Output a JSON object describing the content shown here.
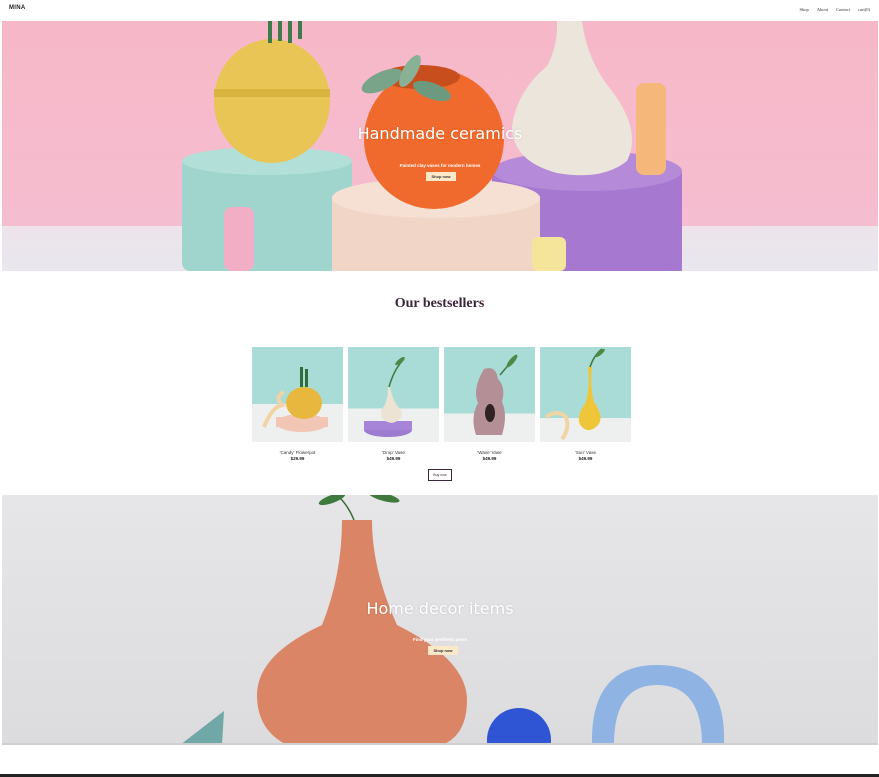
{
  "nav": {
    "logo": "MINA",
    "items": [
      {
        "label": "Shop"
      },
      {
        "label": "About"
      },
      {
        "label": "Contact"
      },
      {
        "label": "cart(0)"
      }
    ]
  },
  "hero": {
    "title": "Handmade ceramics",
    "subtitle": "Painted clay vases for modern homes",
    "button": "Shop now"
  },
  "bestsellers": {
    "title": "Our bestsellers",
    "products": [
      {
        "name": "'Candy' Flowerpot",
        "price": "$29.99"
      },
      {
        "name": "'Drop' Vase",
        "price": "$49.99"
      },
      {
        "name": "'Wave' Vase",
        "price": "$49.99"
      },
      {
        "name": "'Sun' Vase",
        "price": "$49.99"
      }
    ],
    "buy_button": "Buy now"
  },
  "hero2": {
    "title": "Home decor items",
    "subtitle": "Find your aesthetic piece",
    "button": "Shop now"
  },
  "colors": {
    "accent": "#3a2536",
    "button_bg": "#fbe8c9"
  }
}
